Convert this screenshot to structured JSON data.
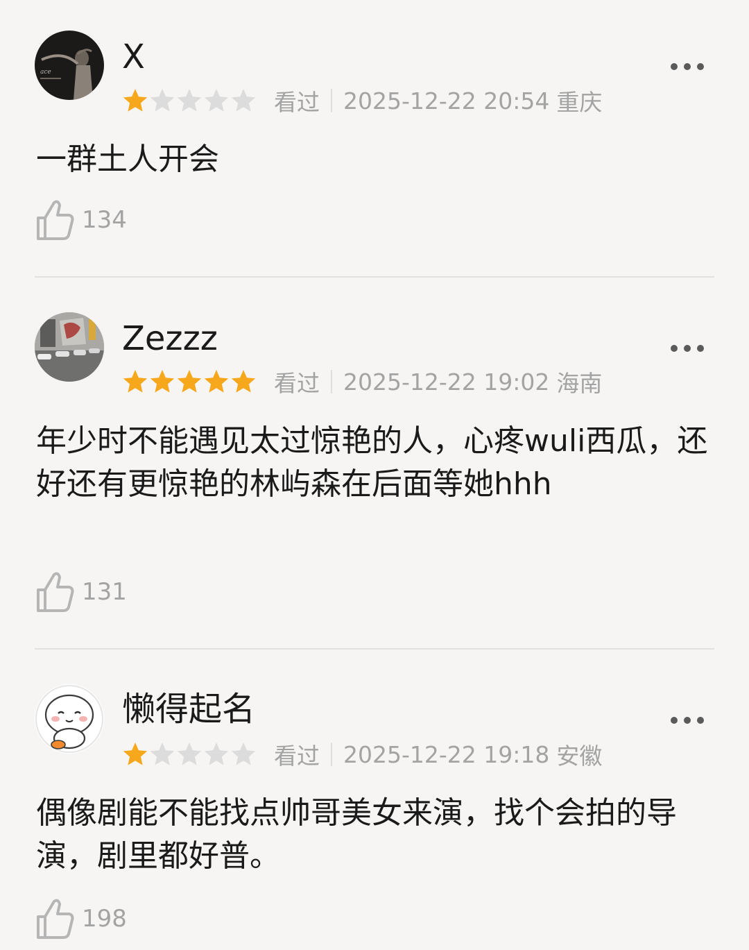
{
  "reviews": [
    {
      "username": "X",
      "rating": 1,
      "status": "看过",
      "datetime": "2025-12-22 20:54",
      "location": "重庆",
      "content": "一群土人开会",
      "likes": "134",
      "avatar_icon": "avatar-dancer-photo"
    },
    {
      "username": "Zezzz",
      "rating": 5,
      "status": "看过",
      "datetime": "2025-12-22 19:02",
      "location": "海南",
      "content": "年少时不能遇见太过惊艳的人，心疼wuli西瓜，还好还有更惊艳的林屿森在后面等她hhh",
      "likes": "131",
      "avatar_icon": "avatar-street-photo"
    },
    {
      "username": "懒得起名",
      "rating": 1,
      "status": "看过",
      "datetime": "2025-12-22 19:18",
      "location": "安徽",
      "content": "偶像剧能不能找点帅哥美女来演，找个会拍的导演，剧里都好普。",
      "likes": "198",
      "avatar_icon": "avatar-cartoon-face"
    }
  ],
  "colors": {
    "background": "#f6f5f3",
    "star_filled": "#f7a71c",
    "star_empty": "#dcdcdc",
    "meta_text": "#a3a3a3",
    "divider": "#e2e1df"
  },
  "icons": {
    "like": "thumbs-up-icon",
    "more": "more-dots-icon",
    "star": "star-icon"
  }
}
